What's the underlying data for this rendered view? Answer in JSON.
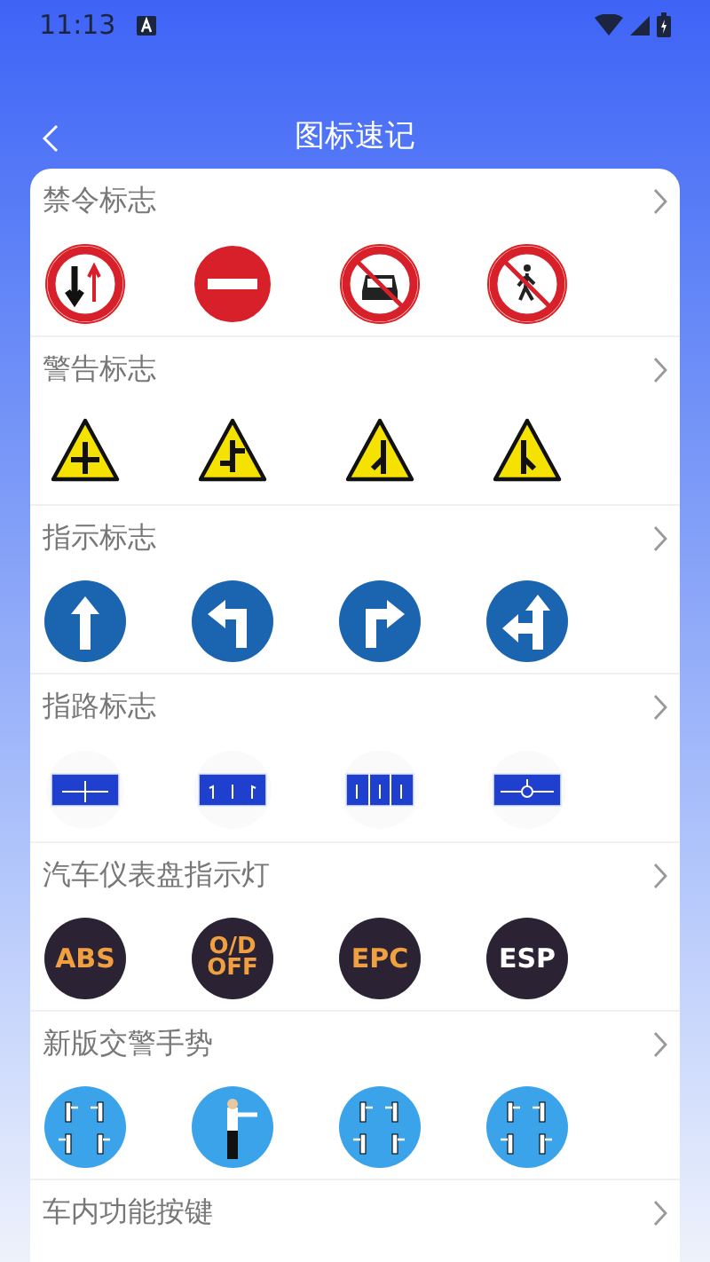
{
  "status_bar": {
    "time": "11:13"
  },
  "header": {
    "title": "图标速记"
  },
  "sections": [
    {
      "title": "禁令标志",
      "items": [
        {
          "kind": "priority-oncoming"
        },
        {
          "kind": "no-entry"
        },
        {
          "kind": "no-cars"
        },
        {
          "kind": "no-pedestrians"
        }
      ]
    },
    {
      "title": "警告标志",
      "items": [
        {
          "kind": "crossroad"
        },
        {
          "kind": "staggered-junction"
        },
        {
          "kind": "side-road-left"
        },
        {
          "kind": "side-road-right"
        }
      ]
    },
    {
      "title": "指示标志",
      "items": [
        {
          "kind": "straight"
        },
        {
          "kind": "turn-left"
        },
        {
          "kind": "turn-right"
        },
        {
          "kind": "straight-left"
        }
      ]
    },
    {
      "title": "指路标志",
      "items": [
        {
          "kind": "guide-cross"
        },
        {
          "kind": "guide-lanes"
        },
        {
          "kind": "guide-panels"
        },
        {
          "kind": "guide-roundabout"
        }
      ]
    },
    {
      "title": "汽车仪表盘指示灯",
      "items": [
        {
          "kind": "light",
          "label": "ABS",
          "color": "#f0a040"
        },
        {
          "kind": "light",
          "label": "O/D OFF",
          "color": "#f0a040"
        },
        {
          "kind": "light",
          "label": "EPC",
          "color": "#f0a040"
        },
        {
          "kind": "light",
          "label": "ESP",
          "color": "#ffffff"
        }
      ]
    },
    {
      "title": "新版交警手势",
      "items": [
        {
          "kind": "gesture-four"
        },
        {
          "kind": "gesture-single"
        },
        {
          "kind": "gesture-four"
        },
        {
          "kind": "gesture-four"
        }
      ]
    },
    {
      "title": "车内功能按键"
    }
  ]
}
